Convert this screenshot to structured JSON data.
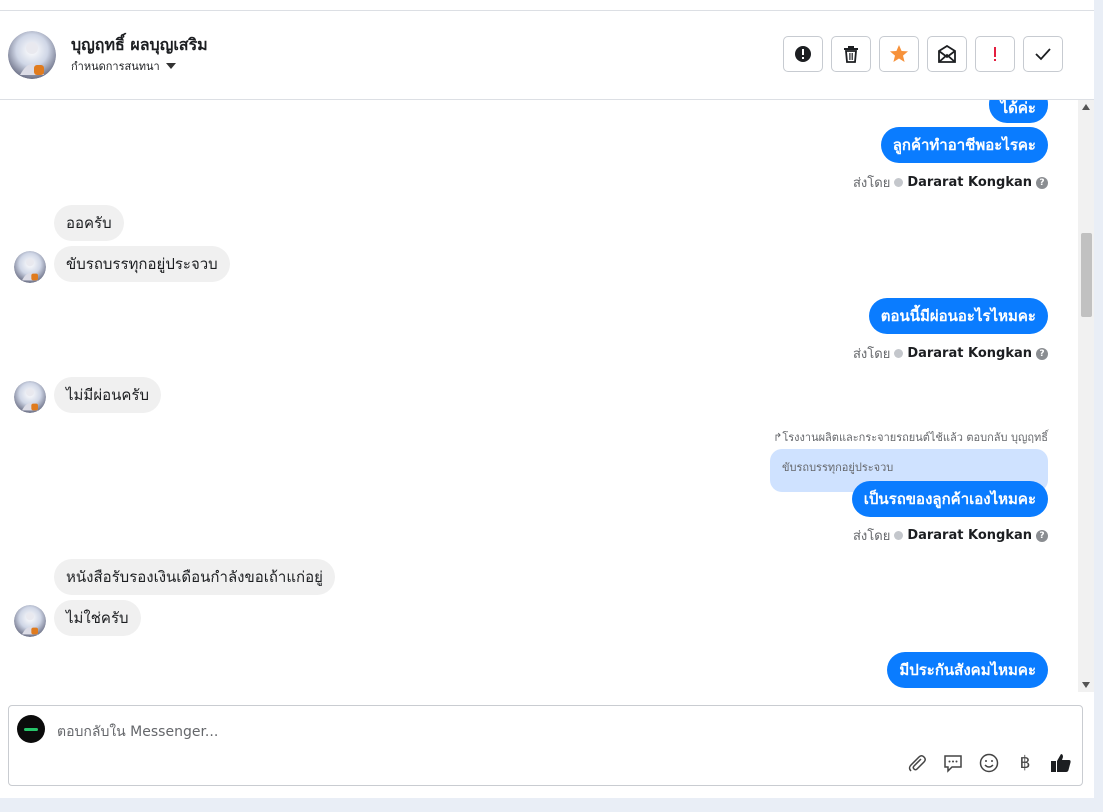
{
  "header": {
    "contact_name": "บุญฤทธิ์ ผลบุญเสริม",
    "assign_label": "กำหนดการสนทนา"
  },
  "actions": [
    {
      "name": "spam-button",
      "icon": "exclamation-circle-icon"
    },
    {
      "name": "delete-button",
      "icon": "trash-icon"
    },
    {
      "name": "star-button",
      "icon": "star-icon",
      "color": "#f7923b"
    },
    {
      "name": "mark-unread-button",
      "icon": "envelope-icon"
    },
    {
      "name": "follow-up-button",
      "icon": "exclamation-icon",
      "color": "#e41e3f"
    },
    {
      "name": "done-button",
      "icon": "check-icon"
    }
  ],
  "messages": {
    "m1": "ได้ค่ะ",
    "m2": "ลูกค้าทำอาชีพอะไรคะ",
    "sent1": {
      "prefix": "ส่งโดย",
      "agent": "Dararat Kongkan"
    },
    "m3": "ออครับ",
    "m4": "ขับรถบรรทุกอยู่ประจวบ",
    "m5": "ตอนนี้มีผ่อนอะไรไหมคะ",
    "sent2": {
      "prefix": "ส่งโดย",
      "agent": "Dararat Kongkan"
    },
    "m6": "ไม่มีผ่อนครับ",
    "reply_note": "โรงงานผลิตและกระจายรถยนต์ไช้แล้ว ตอบกลับ บุญฤทธิ์",
    "quoted": "ขับรถบรรทุกอยู่ประจวบ",
    "m7": "เป็นรถของลูกค้าเองไหมคะ",
    "sent3": {
      "prefix": "ส่งโดย",
      "agent": "Dararat Kongkan"
    },
    "m8": "หนังสือรับรองเงินเดือนกำลังขอเถ้าแก่อยู่",
    "m9": "ไม่ใช่ครับ",
    "m10": "มีประกันสังคมไหมคะ"
  },
  "composer": {
    "placeholder": "ตอบกลับใน Messenger...",
    "tools": [
      "paperclip-icon",
      "saved-reply-icon",
      "emoji-icon",
      "baht-icon",
      "thumbs-up-icon"
    ],
    "baht_symbol": "฿"
  },
  "colors": {
    "outgoing": "#0a7cff",
    "incoming": "#f0f0f0",
    "quoted": "#cfe2ff"
  }
}
